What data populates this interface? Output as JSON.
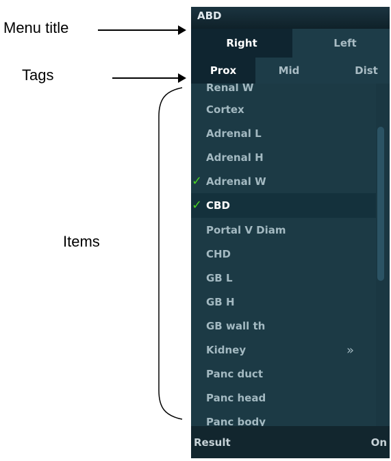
{
  "annotations": {
    "menu_title": "Menu title",
    "tags": "Tags",
    "items": "Items"
  },
  "panel": {
    "title": "ABD",
    "side_tabs": [
      {
        "label": "Right",
        "selected": true
      },
      {
        "label": "Left",
        "selected": false
      }
    ],
    "tags": [
      {
        "label": "Prox",
        "selected": true
      },
      {
        "label": "Mid",
        "selected": false
      },
      {
        "label": "Dist",
        "selected": false
      }
    ],
    "items": [
      {
        "label": "Renal W",
        "checked": false
      },
      {
        "label": "Cortex",
        "checked": false
      },
      {
        "label": "Adrenal L",
        "checked": false
      },
      {
        "label": "Adrenal H",
        "checked": false
      },
      {
        "label": "Adrenal W",
        "checked": true
      },
      {
        "label": "CBD",
        "checked": true,
        "highlighted": true
      },
      {
        "label": "Portal V Diam",
        "checked": false
      },
      {
        "label": "CHD",
        "checked": false
      },
      {
        "label": "GB L",
        "checked": false
      },
      {
        "label": "GB H",
        "checked": false
      },
      {
        "label": "GB wall th",
        "checked": false
      },
      {
        "label": "Kidney",
        "checked": false,
        "submenu": "»"
      },
      {
        "label": "Panc duct",
        "checked": false
      },
      {
        "label": "Panc head",
        "checked": false
      },
      {
        "label": "Panc body",
        "checked": false
      }
    ],
    "check_glyph": "✓",
    "status": {
      "left": "Result",
      "right": "On"
    },
    "colors": {
      "panel_bg": "#1c3a45",
      "selected_bg": "#0f2530",
      "check": "#4ad024"
    }
  }
}
